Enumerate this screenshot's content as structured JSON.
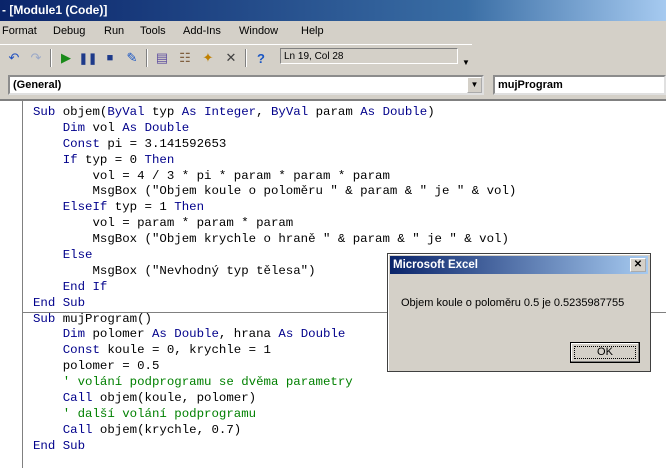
{
  "window": {
    "title": "- [Module1 (Code)]"
  },
  "menu": [
    {
      "label": "Format"
    },
    {
      "label": "Debug"
    },
    {
      "label": "Run"
    },
    {
      "label": "Tools"
    },
    {
      "label": "Add-Ins"
    },
    {
      "label": "Window"
    },
    {
      "label": "Help"
    }
  ],
  "toolbar": {
    "position_label": "Ln 19, Col 28"
  },
  "combos": {
    "object": "(General)",
    "procedure": "mujProgram"
  },
  "code_lines": [
    "Sub objem(ByVal typ As Integer, ByVal param As Double)",
    "    Dim vol As Double",
    "    Const pi = 3.141592653",
    "    If typ = 0 Then",
    "        vol = 4 / 3 * pi * param * param * param",
    "        MsgBox (\"Objem koule o poloměru \" & param & \" je \" & vol)",
    "    ElseIf typ = 1 Then",
    "        vol = param * param * param",
    "        MsgBox (\"Objem krychle o hraně \" & param & \" je \" & vol)",
    "    Else",
    "        MsgBox (\"Nevhodný typ tělesa\")",
    "    End If",
    "End Sub",
    "Sub mujProgram()",
    "    Dim polomer As Double, hrana As Double",
    "    Const koule = 0, krychle = 1",
    "    polomer = 0.5",
    "    ' volání podprogramu se dvěma parametry",
    "    Call objem(koule, polomer)",
    "    ' další volání podprogramu",
    "    Call objem(krychle, 0.7)",
    "End Sub"
  ],
  "dialog": {
    "title": "Microsoft Excel",
    "message": "Objem koule o poloměru 0.5 je 0.5235987755",
    "ok_label": "OK",
    "close_glyph": "✕"
  }
}
